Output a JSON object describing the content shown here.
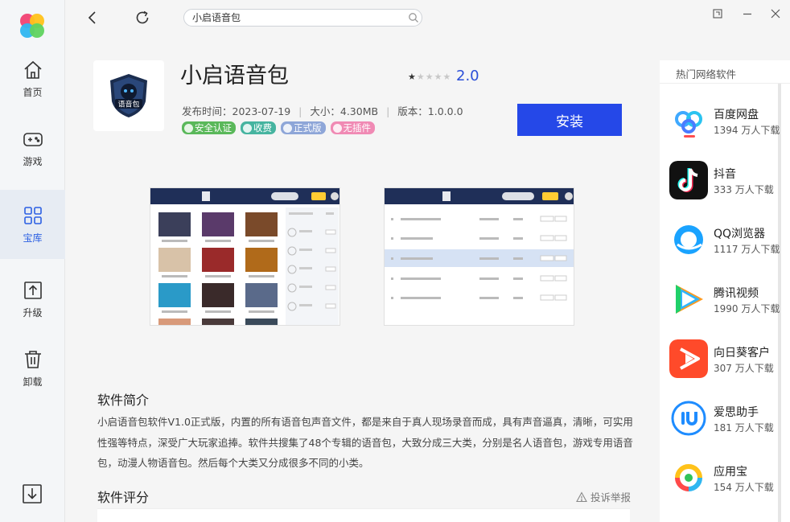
{
  "sidebar": {
    "items": [
      {
        "label": "首页",
        "icon": "home-icon"
      },
      {
        "label": "游戏",
        "icon": "gamepad-icon"
      },
      {
        "label": "宝库",
        "icon": "grid-icon"
      },
      {
        "label": "升级",
        "icon": "upgrade-icon"
      },
      {
        "label": "卸载",
        "icon": "trash-icon"
      }
    ],
    "active_index": 2
  },
  "topbar": {
    "search_value": "小启语音包"
  },
  "app": {
    "title": "小启语音包",
    "rating": "2.0",
    "stars_filled": 1,
    "stars_total": 5,
    "release_label": "发布时间：2023-07-19",
    "size_label": "大小：4.30MB",
    "version_label": "版本：1.0.0.0",
    "icon_text": "语音包",
    "badges": [
      {
        "label": "安全认证",
        "color": "#5ab85a"
      },
      {
        "label": "收费",
        "color": "#46b4a0"
      },
      {
        "label": "正式版",
        "color": "#8ea6d8"
      },
      {
        "label": "无插件",
        "color": "#f08ab4"
      }
    ],
    "install_label": "安装"
  },
  "description": {
    "title": "软件简介",
    "text": "小启语音包软件V1.0正式版，内置的所有语音包声音文件，都是来自于真人现场录音而成，具有声音逼真，清晰，可实用性强等特点，深受广大玩家追捧。软件共搜集了48个专辑的语音包，大致分成三大类，分别是名人语音包，游戏专用语音包，动漫人物语音包。然后每个大类又分成很多不同的小类。"
  },
  "rating_section": {
    "title": "软件评分",
    "report_label": "投诉举报"
  },
  "hot": {
    "title": "热门网络软件",
    "items": [
      {
        "name": "百度网盘",
        "downloads": "1394 万人下载"
      },
      {
        "name": "抖音",
        "downloads": "333 万人下载"
      },
      {
        "name": "QQ浏览器",
        "downloads": "1117 万人下载"
      },
      {
        "name": "腾讯视频",
        "downloads": "1990 万人下载"
      },
      {
        "name": "向日葵客户",
        "downloads": "307 万人下载"
      },
      {
        "name": "爱思助手",
        "downloads": "181 万人下载"
      },
      {
        "name": "应用宝",
        "downloads": "154 万人下载"
      }
    ]
  },
  "colors": {
    "accent": "#2548e8",
    "rating": "#2b4fd8"
  }
}
